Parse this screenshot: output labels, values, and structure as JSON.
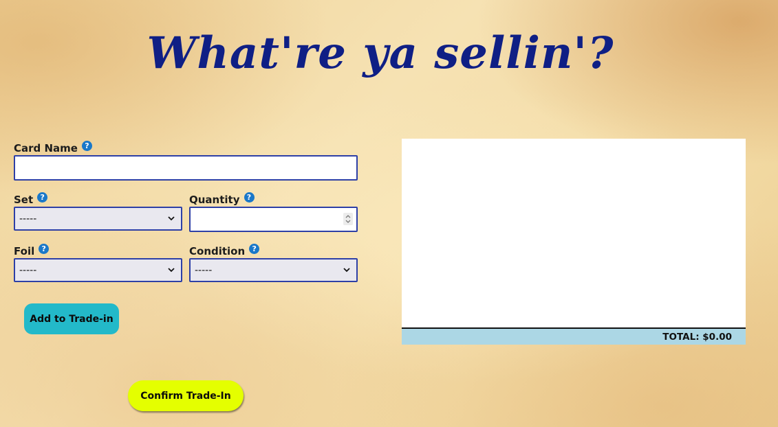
{
  "page": {
    "title": "What're ya sellin'?"
  },
  "form": {
    "card_name": {
      "label": "Card Name",
      "value": "",
      "placeholder": ""
    },
    "set": {
      "label": "Set",
      "selected": "-----"
    },
    "quantity": {
      "label": "Quantity",
      "value": "",
      "placeholder": ""
    },
    "foil": {
      "label": "Foil",
      "selected": "-----"
    },
    "condition": {
      "label": "Condition",
      "selected": "-----"
    },
    "help_glyph": "?",
    "add_button_label": "Add to Trade-in"
  },
  "trade_panel": {
    "total_text": "TOTAL: $0.00"
  },
  "confirm_button_label": "Confirm Trade-In",
  "icons": {
    "help": "question-circle-icon",
    "dropdown": "chevron-down-icon",
    "stepper": "spinner-arrows-icon"
  },
  "colors": {
    "title": "#0f1f85",
    "field_border": "#2d3fa6",
    "help_icon": "#1a78c9",
    "add_button": "#23b9c9",
    "confirm_button": "#e4ff00",
    "total_bar": "#acd7e5"
  }
}
